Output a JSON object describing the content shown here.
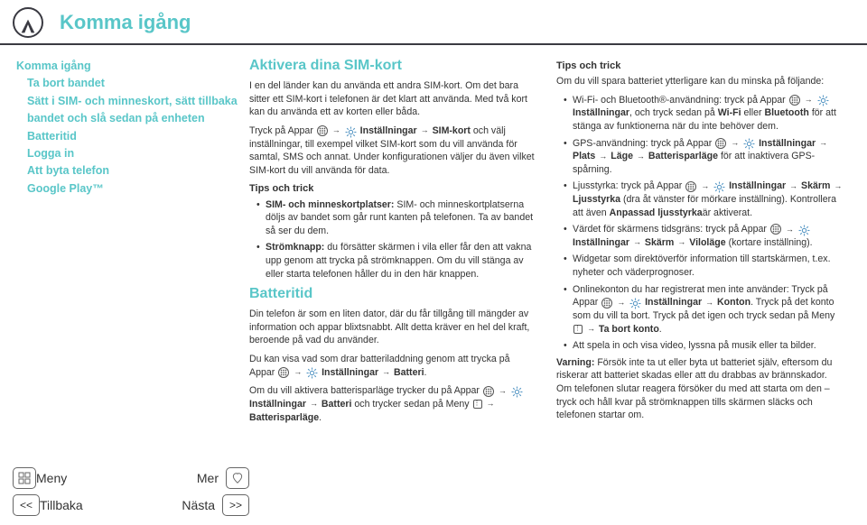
{
  "header": {
    "title": "Komma igång"
  },
  "toc": [
    {
      "label": "Komma igång",
      "lvl": 0
    },
    {
      "label": "Ta bort bandet",
      "lvl": 1
    },
    {
      "label": "Sätt i SIM- och minneskort, sätt tillbaka bandet och slå sedan på enheten",
      "lvl": 1
    },
    {
      "label": "Batteritid",
      "lvl": 1
    },
    {
      "label": "Logga in",
      "lvl": 1
    },
    {
      "label": "Att byta telefon",
      "lvl": 1
    },
    {
      "label": "Google Play™",
      "lvl": 1
    }
  ],
  "col1": {
    "h2a": "Aktivera dina SIM-kort",
    "p1": "I en del länder kan du använda ett andra SIM-kort. Om det bara sitter ett SIM-kort i telefonen är det klart att använda. Med två kort kan du använda ett av korten eller båda.",
    "p2a": "Tryck på Appar",
    "p2b": "Inställningar",
    "p2c": "SIM-kort",
    "p2d": " och välj inställningar, till exempel vilket SIM-kort som du vill använda för samtal, SMS och annat. Under konfigurationen väljer du även vilket SIM-kort du vill använda för data.",
    "h3a": "Tips och trick",
    "li1a": "SIM- och minneskortplatser:",
    "li1b": " SIM- och minneskortplatserna döljs av bandet som går runt kanten på telefonen. Ta av bandet så ser du dem.",
    "li2a": "Strömknapp:",
    "li2b": " du försätter skärmen i vila eller får den att vakna upp genom att trycka på strömknappen. Om du vill stänga av eller starta telefonen håller du in den här knappen.",
    "h2b": "Batteritid",
    "p3": "Din telefon är som en liten dator, där du får tillgång till mängder av information och appar blixtsnabbt. Allt detta kräver en hel del kraft, beroende på vad du använder.",
    "p4a": "Du kan visa vad som drar batteriladdning genom att trycka på Appar",
    "p4b": "Inställningar",
    "p4c": "Batteri",
    "p5a": "Om du vill aktivera batterisparläge trycker du på Appar",
    "p5b": "Inställningar",
    "p5c": "Batteri",
    "p5d": " och trycker sedan på Meny",
    "p5e": "Batterisparläge"
  },
  "col2": {
    "h3a": "Tips och trick",
    "p1": "Om du vill spara batteriet ytterligare kan du minska på följande:",
    "li1a": "Wi-Fi- och Bluetooth®-användning: tryck på Appar",
    "li1b": "Inställningar",
    "li1c": ", och tryck sedan på ",
    "li1d": "Wi-Fi",
    "li1e": " eller ",
    "li1f": "Bluetooth",
    "li1g": " för att stänga av funktionerna när du inte behöver dem.",
    "li2a": "GPS-användning: tryck på Appar",
    "li2b": "Inställningar",
    "li2c": "Plats",
    "li2d": "Läge",
    "li2e": "Batterisparläge",
    "li2f": " för att inaktivera GPS-spårning.",
    "li3a": "Ljusstyrka: tryck på Appar",
    "li3b": "Inställningar",
    "li3c": "Skärm",
    "li3d": "Ljusstyrka",
    "li3e": " (dra åt vänster för mörkare inställning). Kontrollera att även ",
    "li3f": "Anpassad ljusstyrka",
    "li3g": "är aktiverat.",
    "li4a": "Värdet för skärmens tidsgräns: tryck på Appar",
    "li4b": "Inställningar",
    "li4c": "Skärm",
    "li4d": "Viloläge",
    "li4e": " (kortare inställning).",
    "li5": "Widgetar som direktöverför information till startskärmen, t.ex. nyheter och väderprognoser.",
    "li6a": "Onlinekonton du har registrerat men inte använder: Tryck på Appar",
    "li6b": "Inställningar",
    "li6c": "Konton",
    "li6d": ". Tryck på det konto som du vill ta bort. Tryck på det igen och tryck sedan på Meny",
    "li6e": "Ta bort konto",
    "li7": "Att spela in och visa video, lyssna på musik eller ta bilder.",
    "warn_label": "Varning:",
    "warn": " Försök inte ta ut eller byta ut batteriet själv, eftersom du riskerar att batteriet skadas eller att du drabbas av brännskador. Om telefonen slutar reagera försöker du med att starta om den – tryck och håll kvar på strömknappen tills skärmen släcks och telefonen startar om."
  },
  "footer": {
    "menu": "Meny",
    "more": "Mer",
    "back": "Tillbaka",
    "next": "Nästa"
  },
  "icons": {
    "arrow": "→"
  }
}
